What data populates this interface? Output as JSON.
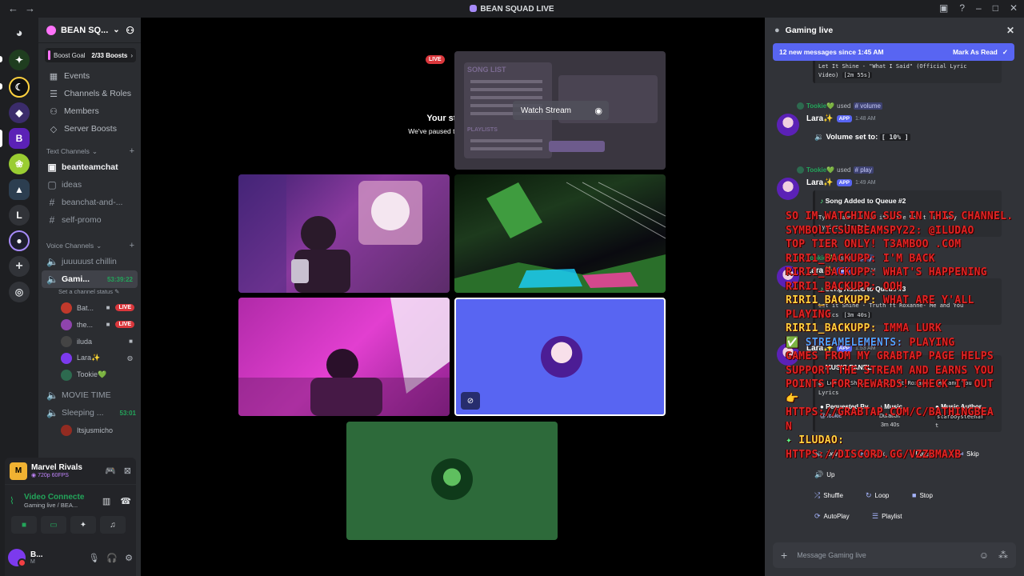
{
  "window": {
    "title": "BEAN SQUAD LIVE"
  },
  "server": {
    "name": "BEAN SQ...",
    "boost_label": "Boost Goal",
    "boost_count": "2/33 Boosts"
  },
  "nav_items": [
    {
      "label": "Events",
      "icon": "calendar-icon"
    },
    {
      "label": "Channels & Roles",
      "icon": "list-icon"
    },
    {
      "label": "Members",
      "icon": "members-icon"
    },
    {
      "label": "Server Boosts",
      "icon": "boost-icon"
    }
  ],
  "text_category": "Text Channels",
  "text_channels": [
    {
      "name": "beanteamchat",
      "bold": true
    },
    {
      "name": "ideas",
      "bold": false
    },
    {
      "name": "beanchat-and-...",
      "bold": false
    },
    {
      "name": "self-promo",
      "bold": false
    }
  ],
  "voice_category": "Voice Channels",
  "voice_channels": {
    "first": "juuuuust chillin",
    "active": {
      "name": "Gami...",
      "timer": "53:39:22",
      "status": "Set a channel status"
    },
    "users": [
      {
        "name": "Bat...",
        "live": "LIVE",
        "color": "#c0392b"
      },
      {
        "name": "the...",
        "live": "LIVE",
        "color": "#8e44ad"
      },
      {
        "name": "iluda",
        "live": "",
        "color": "#444444"
      },
      {
        "name": "Lara✨",
        "live": "",
        "color": "#7c3aed"
      },
      {
        "name": "Tookie💚",
        "live": "",
        "color": "#2d6a4f"
      }
    ],
    "movie": "MOVIE TIME",
    "sleeping": {
      "name": "Sleeping ...",
      "timer": "53:01",
      "user": "Itsjusmicho"
    }
  },
  "user_panel": {
    "game": "Marvel Rivals",
    "game_sub": "720p 60FPS",
    "vc_title": "Video Connecte",
    "vc_sub": "Gaming live / BEA...",
    "me_name": "B...",
    "me_sub": "M"
  },
  "stage": {
    "live_tag": "LIVE",
    "paused_title": "Your stream is still running!",
    "paused_sub": "We've paused this preview to save your resources.",
    "watch_label": "Watch Stream",
    "preview_song_list": "SONG LIST",
    "preview_playlists": "PLAYLISTS"
  },
  "chat": {
    "channel": "Gaming live",
    "new_messages": "12 new messages since 1:45 AM",
    "mark_read": "Mark As Read",
    "composer_placeholder": "Message Gaming live",
    "top_embed_line1": "Let It Shine - \"What I Said\" (Official Lyric",
    "top_embed_line2": "Video)",
    "top_embed_dur": "[2m 55s]",
    "messages": [
      {
        "reply_user": "Tookie💚",
        "reply_used": "used",
        "reply_cmd": "# volume",
        "author": "Lara✨",
        "app": "APP",
        "time": "1:48 AM"
      },
      {
        "reply_user": "Tookie💚",
        "reply_used": "used",
        "reply_cmd": "# play",
        "author": "Lara✨",
        "app": "APP",
        "time": "1:49 AM"
      },
      {
        "reply_user": "Tookie💚",
        "reply_used": "used",
        "reply_cmd": "# play",
        "author": "Lara✨",
        "app": "APP",
        "time": "1:50 AM"
      },
      {
        "author": "Lara✨",
        "app": "APP",
        "time": "1:53 AM"
      }
    ],
    "volume_text": "Volume set to:",
    "volume_value": "[ 10% ]",
    "queue2_title": "Song Added to Queue #2",
    "queue2_line": "Tyler James.W Let it Shine Don't Run Away",
    "queue2_line2": "Lyrics",
    "queue2_dur": "[3m 8s]",
    "queue3_title": "Song Added to Queue #3",
    "queue3_line": "Let it Shine - Truth ft Roxanne- Me and You",
    "queue3_line2": "Lyrics",
    "queue3_dur": "[3m 40s]",
    "music_panel": {
      "title": "MUSIC PANEL",
      "now_playing": "Let it Shine - Truth ft Roxanne- Me and You",
      "lyrics_label": "Lyrics",
      "requested_by": "Requested By",
      "requester": "Music",
      "duration_label": "Duration",
      "duration": "3m 40s",
      "author_label": "Music Author",
      "author": "starboysteenar",
      "author_tail": "t",
      "requester_tag": "@Tookie",
      "buttons": [
        {
          "label": "Down",
          "icon": "volume-down-icon"
        },
        {
          "label": "Back",
          "icon": "back-icon"
        },
        {
          "label": "Pause",
          "icon": "pause-icon"
        },
        {
          "label": "Skip",
          "icon": "skip-icon"
        },
        {
          "label": "Up",
          "icon": "volume-up-icon"
        },
        {
          "label": "Shuffle",
          "icon": "shuffle-icon"
        },
        {
          "label": "Loop",
          "icon": "loop-icon"
        },
        {
          "label": "Stop",
          "icon": "stop-icon"
        },
        {
          "label": "AutoPlay",
          "icon": "autoplay-icon"
        },
        {
          "label": "Playlist",
          "icon": "playlist-icon"
        }
      ]
    }
  },
  "overlay": {
    "l1": "SO IM WATCHING SUS IN THIS CHANNEL.",
    "l2": "SYMBOLICSUNBEAMSPY22: @ILUDAO",
    "l3": "TOP TIER ONLY! T3AMBOO .COM",
    "l4": "RIRI1_BACKUPP: I'M BACK",
    "l5": "RIRI1_BACKUPP: WHAT'S HAPPENING",
    "l6": "RIRI1_BACKUPP: OOH",
    "l7a": "RIRI1_BACKUPP:",
    "l7b": " WHAT ARE Y'ALL",
    "l8": "PLAYING",
    "l9a": "RIRI1_BACKUPP:",
    "l9b": " IMMA LURK",
    "l10a": "✅ ",
    "l10b": "STREAMELEMENTS:",
    "l10c": " PLAYING",
    "l11": "GAMES FROM MY GRABTAP PAGE HELPS",
    "l12": "SUPPORT THE STREAM AND EARNS YOU",
    "l13": "POINTS FOR REWARDS! CHECK IT OUT",
    "l14": "👉",
    "l15": "HTTPS://GRABTAP.COM/C/BATHINGBEA",
    "l16": "N",
    "l17": "ILUDAO:",
    "l18": "HTTPS://DISCORD.GG/VZZBMAXB"
  }
}
